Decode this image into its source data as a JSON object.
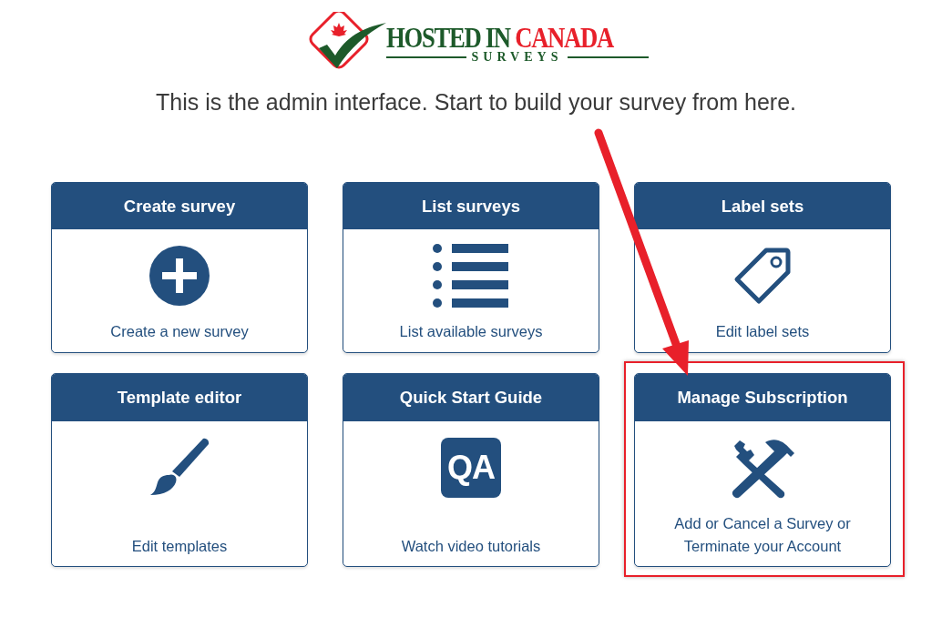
{
  "logo": {
    "word_1": "HOSTED IN",
    "word_2": "CANADA",
    "subtitle": "SURVEYS"
  },
  "tagline": "This is the admin interface. Start to build your survey from here.",
  "cards": [
    {
      "title": "Create survey",
      "text": "Create a new survey",
      "highlighted": false
    },
    {
      "title": "List surveys",
      "text": "List available surveys",
      "highlighted": false
    },
    {
      "title": "Label sets",
      "text": "Edit label sets",
      "highlighted": false
    },
    {
      "title": "Template editor",
      "text": "Edit templates",
      "highlighted": false
    },
    {
      "title": "Quick Start Guide",
      "icon_text": "QA",
      "text": "Watch video tutorials",
      "highlighted": false
    },
    {
      "title": "Manage Subscription",
      "text": "Add or Cancel a Survey or Terminate your Account",
      "highlighted": true
    }
  ],
  "annotation": {
    "kind": "arrow"
  }
}
